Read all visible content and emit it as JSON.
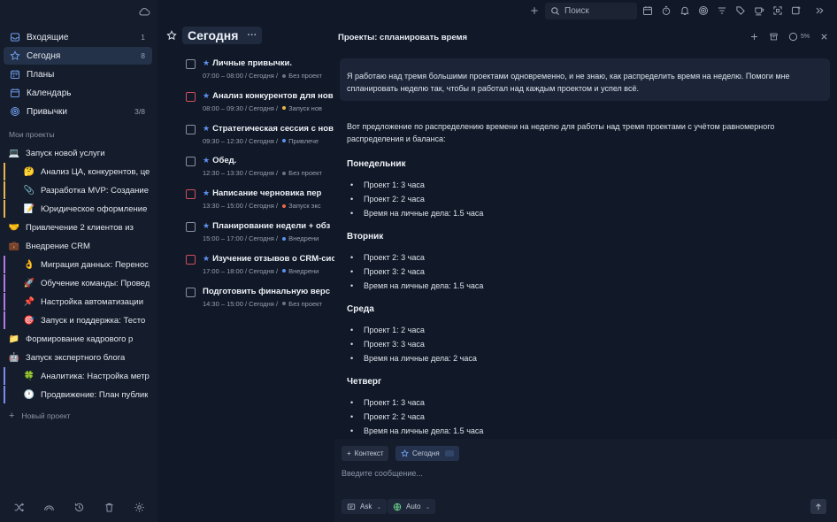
{
  "sidebar": {
    "nav": [
      {
        "label": "Входящие",
        "count": "1",
        "icon": "inbox-icon"
      },
      {
        "label": "Сегодня",
        "count": "8",
        "icon": "star-icon"
      },
      {
        "label": "Планы",
        "count": "",
        "icon": "calendar-grid-icon"
      },
      {
        "label": "Календарь",
        "count": "",
        "icon": "calendar-icon"
      },
      {
        "label": "Привычки",
        "count": "3/8",
        "icon": "target-icon"
      }
    ],
    "section_title": "Мои проекты",
    "projects": [
      {
        "emoji": "💻",
        "label": "Запуск новой услуги",
        "child": false,
        "bar": ""
      },
      {
        "emoji": "🤔",
        "label": "Анализ ЦА, конкурентов, це",
        "child": true,
        "bar": "#e8b64a"
      },
      {
        "emoji": "📎",
        "label": "Разработка MVP: Создание",
        "child": true,
        "bar": "#e8b64a"
      },
      {
        "emoji": "📝",
        "label": "Юридическое оформление",
        "child": true,
        "bar": "#e8b64a"
      },
      {
        "emoji": "🤝",
        "label": "Привлечение 2 клиентов из",
        "child": false,
        "bar": ""
      },
      {
        "emoji": "💼",
        "label": "Внедрение CRM",
        "child": false,
        "bar": ""
      },
      {
        "emoji": "👌",
        "label": "Миграция данных: Перенос",
        "child": true,
        "bar": "#b07be6"
      },
      {
        "emoji": "🚀",
        "label": "Обучение команды: Провед",
        "child": true,
        "bar": "#b07be6"
      },
      {
        "emoji": "📌",
        "label": "Настройка автоматизации",
        "child": true,
        "bar": "#b07be6"
      },
      {
        "emoji": "🎯",
        "label": "Запуск и поддержка: Тесто",
        "child": true,
        "bar": "#b07be6"
      },
      {
        "emoji": "📁",
        "label": "Формирование кадрового р",
        "child": false,
        "bar": ""
      },
      {
        "emoji": "🤖",
        "label": "Запуск экспертного блога",
        "child": false,
        "bar": ""
      },
      {
        "emoji": "🍀",
        "label": "Аналитика: Настройка метр",
        "child": true,
        "bar": "#7b8cf0"
      },
      {
        "emoji": "🕐",
        "label": "Продвижение: План публик",
        "child": true,
        "bar": "#7b8cf0"
      }
    ],
    "new_project": "Новый проект"
  },
  "tasks": {
    "title": "Сегодня",
    "items": [
      {
        "name": "Личные привычки.",
        "starred": true,
        "red": false,
        "time": "07:00 – 08:00 / Сегодня",
        "project": "Без проект",
        "dot": "#6b7384"
      },
      {
        "name": "Анализ конкурентов для нов",
        "starred": true,
        "red": true,
        "time": "08:00 – 09:30 / Сегодня",
        "project": "Запуск нов",
        "dot": "#e8b64a"
      },
      {
        "name": "Стратегическая сессия с нов",
        "starred": true,
        "red": false,
        "time": "09:30 – 12:30 / Сегодня",
        "project": "Привлече",
        "dot": "#5e92ee"
      },
      {
        "name": "Обед.",
        "starred": true,
        "red": false,
        "time": "12:30 – 13:30 / Сегодня",
        "project": "Без проект",
        "dot": "#6b7384"
      },
      {
        "name": "Написание черновика пер",
        "starred": true,
        "red": true,
        "time": "13:30 – 15:00 / Сегодня",
        "project": "Запуск экс",
        "dot": "#e86a4a"
      },
      {
        "name": "Планирование недели + обз",
        "starred": true,
        "red": false,
        "time": "15:00 – 17:00 / Сегодня",
        "project": "Внедрени",
        "dot": "#5e92ee"
      },
      {
        "name": "Изучение отзывов о CRM-сис",
        "starred": true,
        "red": true,
        "time": "17:00 – 18:00 / Сегодня",
        "project": "Внедрени",
        "dot": "#5e92ee"
      },
      {
        "name": "Подготовить финальную верс",
        "starred": false,
        "red": false,
        "time": "14:30 – 15:00 / Сегодня",
        "project": "Без проект",
        "dot": "#6b7384"
      }
    ]
  },
  "topbar": {
    "search_placeholder": "Поиск"
  },
  "chat": {
    "title": "Проекты: спланировать время",
    "percent": "5%",
    "user_message": "Я работаю над тремя большими проектами одновременно, и не знаю, как распределить время на неделю. Помоги мне спланировать неделю так, чтобы я работал над каждым проектом и успел всё.",
    "answer_intro": "Вот предложение по распределению времени на неделю для работы над тремя проектами с учётом равномерного распределения и баланса:",
    "days": [
      {
        "name": "Понедельник",
        "items": [
          "Проект 1: 3 часа",
          "Проект 2: 2 часа",
          "Время на личные дела: 1.5 часа"
        ]
      },
      {
        "name": "Вторник",
        "items": [
          "Проект 2: 3 часа",
          "Проект 3: 2 часа",
          "Время на личные дела: 1.5 часа"
        ]
      },
      {
        "name": "Среда",
        "items": [
          "Проект 1: 2 часа",
          "Проект 3: 3 часа",
          "Время на личные дела: 2 часа"
        ]
      },
      {
        "name": "Четверг",
        "items": [
          "Проект 1: 3 часа",
          "Проект 2: 2 часа",
          "Время на личные дела: 1.5 часа"
        ]
      }
    ],
    "chip_context": "Контекст",
    "chip_today": "Сегодня",
    "input_placeholder": "Введите сообщение...",
    "mode_ask": "Ask",
    "mode_auto": "Auto"
  },
  "colors": {
    "accent": "#5e92ee",
    "overdue": "#d14f5e"
  }
}
